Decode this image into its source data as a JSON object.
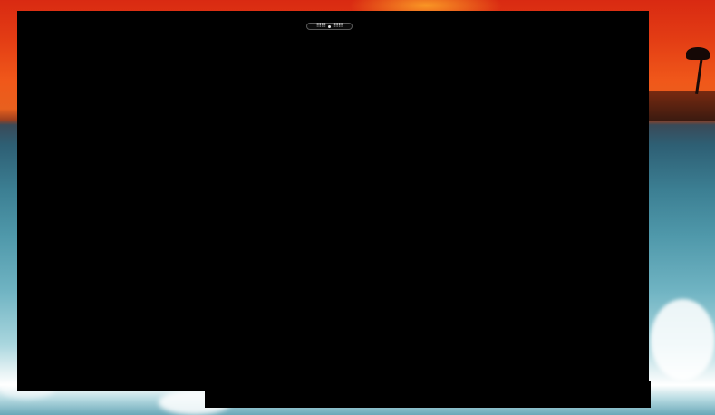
{
  "desktop": {
    "wallpaper": "tropical-sunset-ocean",
    "colors": {
      "sky_top": "#d92a12",
      "sky_horizon": "#f0581a",
      "water": "#3c7f93",
      "foam": "#ffffff",
      "window": "#000000"
    }
  },
  "window_handle": {
    "icon_left": "grip-dots-icon",
    "icon_center": "center-dot-icon",
    "icon_right": "grip-dots-icon",
    "grip_text": "⠿⠿⠿"
  }
}
